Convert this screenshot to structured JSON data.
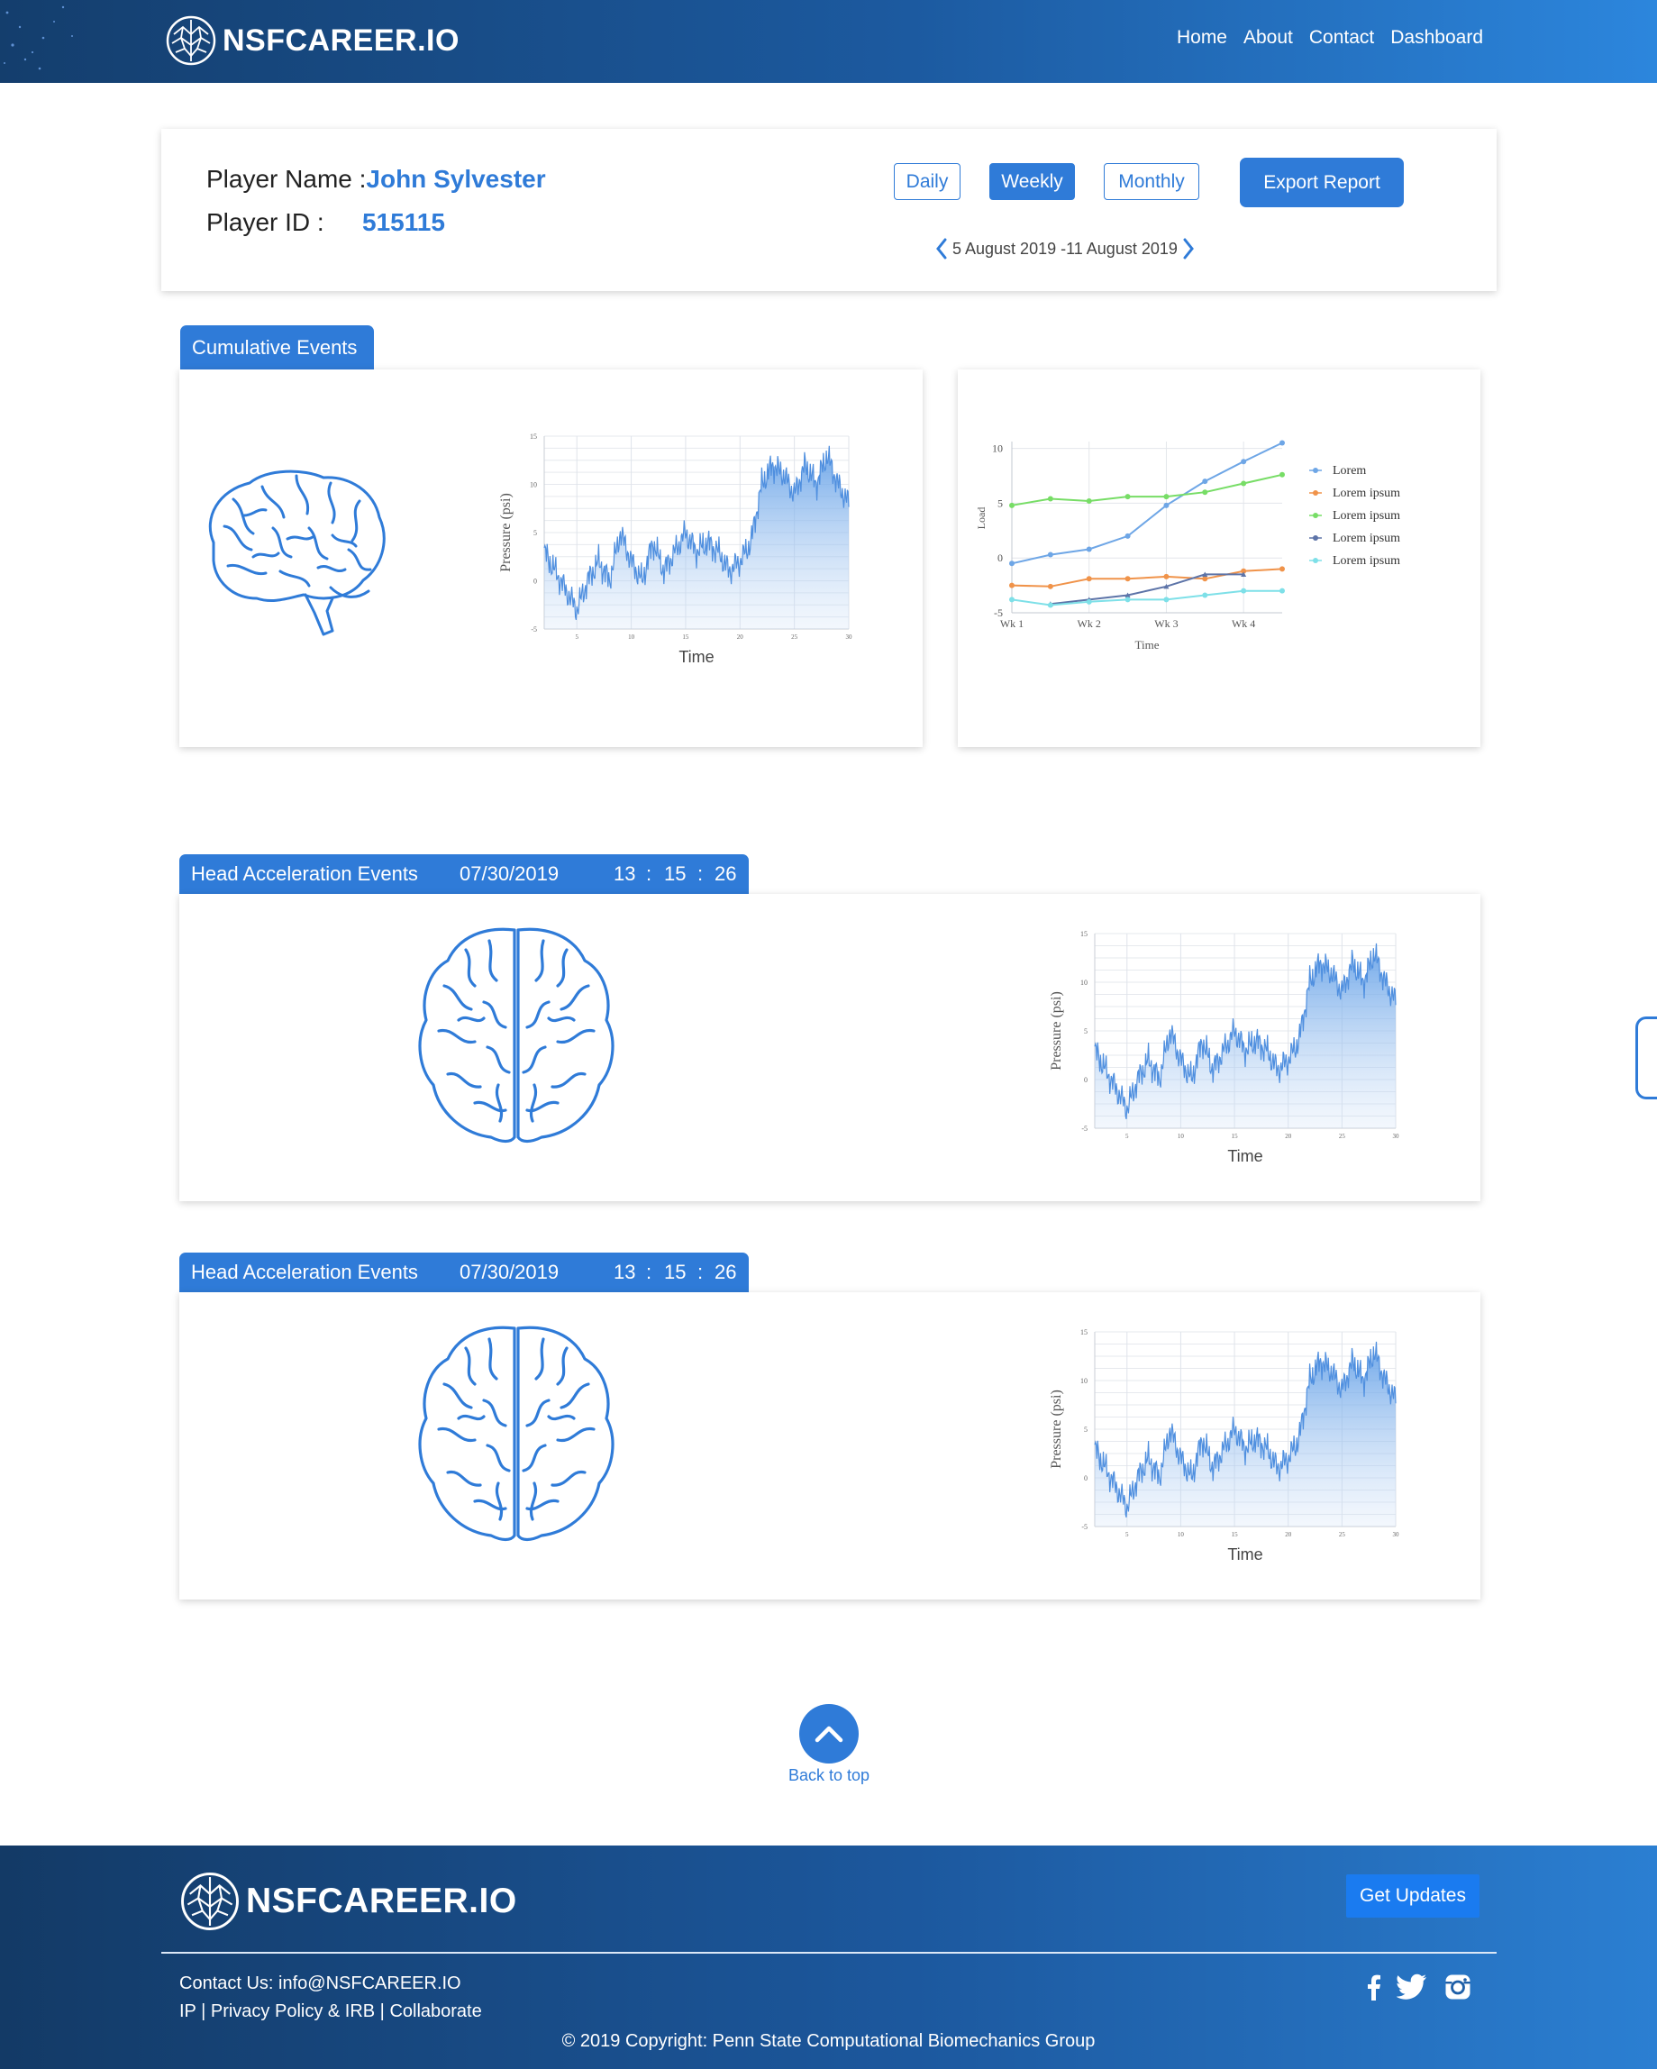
{
  "brand": "NSFCAREER.IO",
  "nav": [
    "Home",
    "About",
    "Contact",
    "Dashboard"
  ],
  "player": {
    "name_label": "Player Name :",
    "name": "John Sylvester",
    "id_label": "Player ID :",
    "id": "515115"
  },
  "periods": [
    "Daily",
    "Weekly",
    "Monthly"
  ],
  "active_period": "Weekly",
  "export_label": "Export Report",
  "date_range": "5 August 2019 -11 August 2019",
  "cumulative_tab": "Cumulative Events",
  "head_events": [
    {
      "title": "Head Acceleration Events",
      "date": "07/30/2019",
      "time": [
        "13",
        "15",
        "26"
      ]
    },
    {
      "title": "Head Acceleration Events",
      "date": "07/30/2019",
      "time": [
        "13",
        "15",
        "26"
      ]
    }
  ],
  "back_to_top": "Back to top",
  "footer": {
    "contact": "Contact Us: info@NSFCAREER.IO",
    "links": [
      "IP",
      "Privacy Policy & IRB",
      "Collaborate"
    ],
    "copyright": "© 2019 Copyright: Penn State Computational Biomechanics Group",
    "updates_label": "Get Updates"
  },
  "colors": {
    "accent": "#2f7bd8",
    "header_start": "#143e6d",
    "header_end": "#2c86dd"
  },
  "icons": [
    "brain-logo-icon",
    "chevron-left-icon",
    "chevron-right-icon",
    "brain-side-icon",
    "brain-top-icon",
    "chevron-up-icon",
    "facebook-icon",
    "twitter-icon",
    "instagram-icon"
  ],
  "chart_data": [
    {
      "type": "area",
      "xlabel": "Time",
      "ylabel": "Pressure (psi)",
      "xticks": [
        "5",
        "10",
        "15",
        "20",
        "25",
        "30"
      ],
      "yticks": [
        "-5",
        "0",
        "5",
        "10",
        "15"
      ],
      "xlim": [
        2,
        30
      ],
      "ylim": [
        -5,
        15
      ],
      "x": [
        2,
        3,
        4,
        5,
        6,
        7,
        8,
        9,
        10,
        11,
        12,
        13,
        14,
        15,
        16,
        17,
        18,
        19,
        20,
        21,
        22,
        23,
        24,
        25,
        26,
        27,
        28,
        29,
        30
      ],
      "y": [
        3,
        1,
        -1,
        -3,
        0,
        2,
        0,
        5,
        2,
        0,
        4,
        1,
        3,
        5,
        3,
        4,
        3,
        1,
        2,
        4,
        10,
        12,
        11,
        9,
        12,
        10,
        13,
        10,
        8
      ]
    },
    {
      "type": "line",
      "xlabel": "Time",
      "ylabel": "Load",
      "categories": [
        "Wk 1",
        "Wk 2",
        "Wk 3",
        "Wk 4"
      ],
      "yticks": [
        "-5",
        "0",
        "5",
        "10"
      ],
      "ylim": [
        -5,
        10
      ],
      "x": [
        1,
        1.5,
        2,
        2.5,
        3,
        3.5,
        4,
        4.5
      ],
      "series": [
        {
          "name": "Lorem",
          "color": "#6ea6e6",
          "values": [
            -0.5,
            0.3,
            0.8,
            2.0,
            4.8,
            7.0,
            8.8,
            10.5
          ]
        },
        {
          "name": "Lorem ipsum",
          "color": "#f0934a",
          "values": [
            -2.5,
            -2.6,
            -1.9,
            -1.9,
            -1.7,
            -1.9,
            -1.2,
            -1.0
          ]
        },
        {
          "name": "Lorem ipsum",
          "color": "#77dd66",
          "values": [
            4.8,
            5.4,
            5.2,
            5.6,
            5.6,
            6.0,
            6.8,
            7.6
          ]
        },
        {
          "name": "Lorem ipsum",
          "color": "#5d74a8",
          "values": [
            null,
            -4.2,
            -3.8,
            -3.4,
            -2.6,
            -1.5,
            -1.5,
            null
          ]
        },
        {
          "name": "Lorem ipsum",
          "color": "#7ee0e8",
          "values": [
            -3.8,
            -4.3,
            -4.0,
            -3.8,
            -3.8,
            -3.4,
            -3.0,
            -3.0
          ]
        }
      ]
    },
    {
      "type": "area",
      "xlabel": "Time",
      "ylabel": "Pressure (psi)",
      "xticks": [
        "5",
        "10",
        "15",
        "20",
        "25",
        "30"
      ],
      "yticks": [
        "-5",
        "0",
        "5",
        "10",
        "15"
      ],
      "xlim": [
        2,
        30
      ],
      "ylim": [
        -5,
        15
      ],
      "x": [
        2,
        3,
        4,
        5,
        6,
        7,
        8,
        9,
        10,
        11,
        12,
        13,
        14,
        15,
        16,
        17,
        18,
        19,
        20,
        21,
        22,
        23,
        24,
        25,
        26,
        27,
        28,
        29,
        30
      ],
      "y": [
        3,
        1,
        -1,
        -3,
        0,
        2,
        0,
        5,
        2,
        0,
        4,
        1,
        3,
        5,
        3,
        4,
        3,
        1,
        2,
        4,
        10,
        12,
        11,
        9,
        12,
        10,
        13,
        10,
        8
      ]
    },
    {
      "type": "area",
      "xlabel": "Time",
      "ylabel": "Pressure (psi)",
      "xticks": [
        "5",
        "10",
        "15",
        "20",
        "25",
        "30"
      ],
      "yticks": [
        "-5",
        "0",
        "5",
        "10",
        "15"
      ],
      "xlim": [
        2,
        30
      ],
      "ylim": [
        -5,
        15
      ],
      "x": [
        2,
        3,
        4,
        5,
        6,
        7,
        8,
        9,
        10,
        11,
        12,
        13,
        14,
        15,
        16,
        17,
        18,
        19,
        20,
        21,
        22,
        23,
        24,
        25,
        26,
        27,
        28,
        29,
        30
      ],
      "y": [
        3,
        1,
        -1,
        -3,
        0,
        2,
        0,
        5,
        2,
        0,
        4,
        1,
        3,
        5,
        3,
        4,
        3,
        1,
        2,
        4,
        10,
        12,
        11,
        9,
        12,
        10,
        13,
        10,
        8
      ]
    }
  ]
}
